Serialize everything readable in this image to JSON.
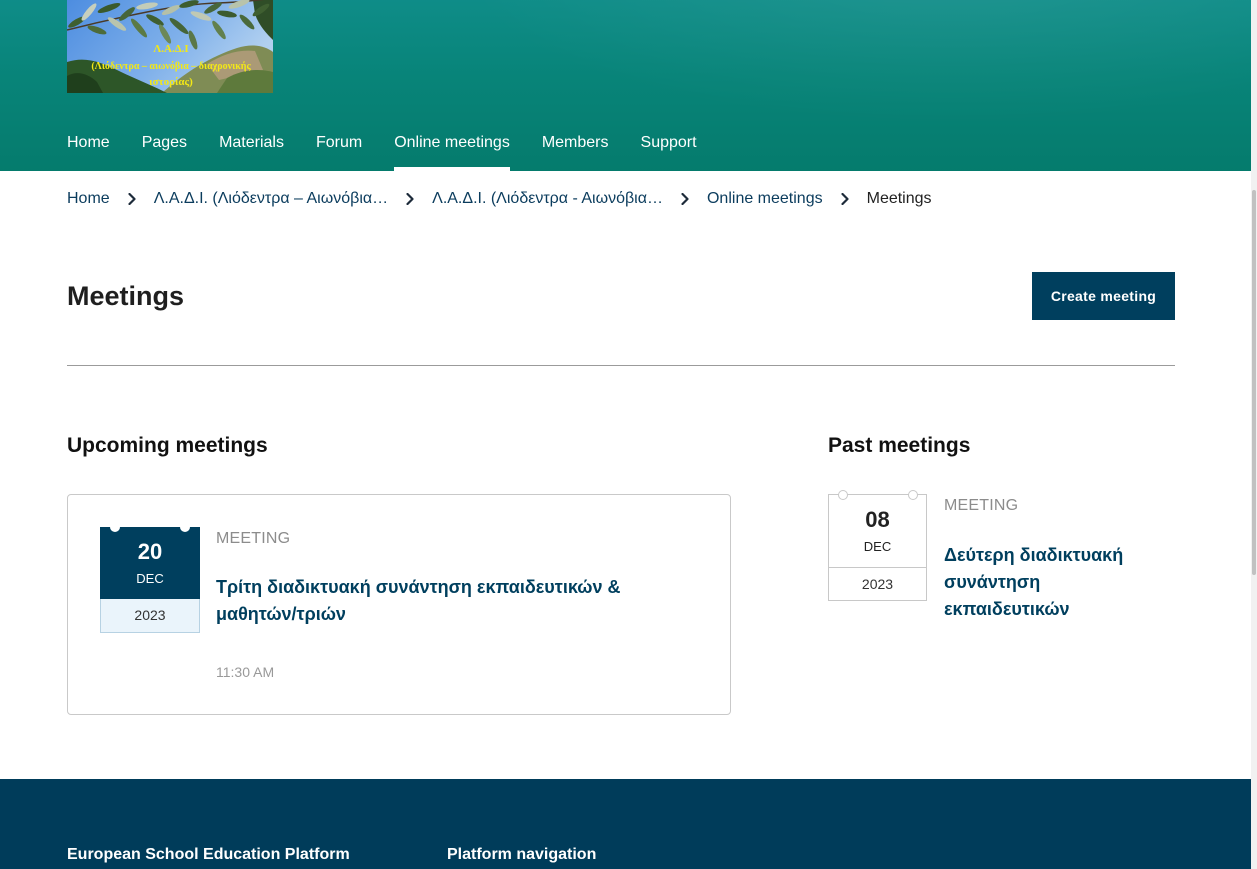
{
  "logo": {
    "lines": [
      "Λ.Α.Δ.Ι",
      "(Λιόδεντρα – αιωνόβια – διαχρονικής",
      "ιστορίας)"
    ]
  },
  "nav": {
    "items": [
      {
        "label": "Home",
        "active": false
      },
      {
        "label": "Pages",
        "active": false
      },
      {
        "label": "Materials",
        "active": false
      },
      {
        "label": "Forum",
        "active": false
      },
      {
        "label": "Online meetings",
        "active": true
      },
      {
        "label": "Members",
        "active": false
      },
      {
        "label": "Support",
        "active": false
      }
    ]
  },
  "breadcrumb": {
    "separator_icon": "chevron-right-icon",
    "items": [
      {
        "label": "Home"
      },
      {
        "label": "Λ.Α.Δ.Ι. (Λιόδεντρα – Αιωνόβια…"
      },
      {
        "label": "Λ.Α.Δ.Ι. (Λιόδεντρα - Αιωνόβια…"
      },
      {
        "label": "Online meetings"
      },
      {
        "label": "Meetings",
        "current": true
      }
    ]
  },
  "page": {
    "title": "Meetings",
    "create_button": "Create meeting"
  },
  "upcoming": {
    "heading": "Upcoming meetings",
    "meetings": [
      {
        "day": "20",
        "month": "DEC",
        "year": "2023",
        "type": "MEETING",
        "title": "Τρίτη διαδικτυακή συνάντηση εκπαιδευτικών & μαθητών/τριών",
        "time": "11:30 AM"
      }
    ]
  },
  "past": {
    "heading": "Past meetings",
    "meetings": [
      {
        "day": "08",
        "month": "DEC",
        "year": "2023",
        "type": "MEETING",
        "title": "Δεύτερη διαδικτυακή συνάντηση εκπαιδευτικών"
      }
    ]
  },
  "footer": {
    "platform_heading": "European School Education Platform",
    "navigation_heading": "Platform navigation"
  },
  "colors": {
    "header_teal": "#088479",
    "navy": "#003f5e",
    "muted_text": "#8c8c8c",
    "footer": "#003c5a"
  }
}
